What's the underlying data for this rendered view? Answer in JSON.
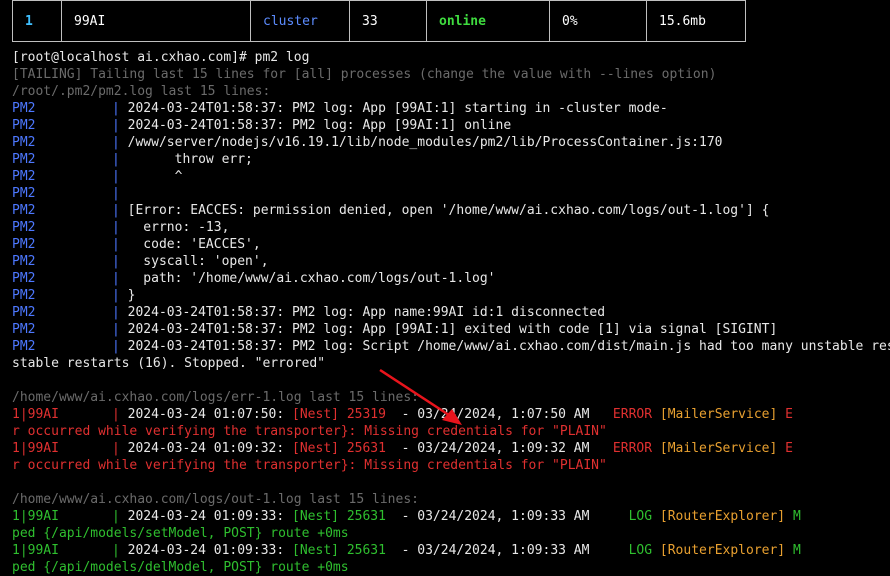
{
  "process_row": {
    "id": "1",
    "name": "99AI",
    "mode": "cluster",
    "restarts": "33",
    "status": "online",
    "cpu": "0%",
    "memory": "15.6mb"
  },
  "prompt": "[root@localhost ai.cxhao.com]# pm2 log",
  "tailing": "[TAILING] Tailing last 15 lines for [all] processes (change the value with --lines option)",
  "pm2_log_path": "/root/.pm2/pm2.log last 15 lines:",
  "pm2_prefix": "PM2",
  "pm2_lines": [
    "2024-03-24T01:58:37: PM2 log: App [99AI:1] starting in -cluster mode-",
    "2024-03-24T01:58:37: PM2 log: App [99AI:1] online",
    "/www/server/nodejs/v16.19.1/lib/node_modules/pm2/lib/ProcessContainer.js:170",
    "      throw err;",
    "      ^",
    "",
    "[Error: EACCES: permission denied, open '/home/www/ai.cxhao.com/logs/out-1.log'] {",
    "  errno: -13,",
    "  code: 'EACCES',",
    "  syscall: 'open',",
    "  path: '/home/www/ai.cxhao.com/logs/out-1.log'",
    "}",
    "2024-03-24T01:58:37: PM2 log: App name:99AI id:1 disconnected",
    "2024-03-24T01:58:37: PM2 log: App [99AI:1] exited with code [1] via signal [SIGINT]",
    "2024-03-24T01:58:37: PM2 log: Script /home/www/ai.cxhao.com/dist/main.js had too many unstable restarts (16). Stopped. \"errored\""
  ],
  "wrap_line": "stable restarts (16). Stopped. \"errored\"",
  "err_log_path": "/home/www/ai.cxhao.com/logs/err-1.log last 15 lines:",
  "err_prefix": "1|99AI",
  "err_entries": [
    {
      "ts": "2024-03-24 01:07:50: ",
      "nest": "[Nest] 25319",
      "dash": "  - ",
      "date": "03/24/2024, 1:07:50 AM",
      "level": "   ERROR ",
      "ctx": "[MailerService]",
      "tail": " E",
      "cont": "r occurred while verifying the transporter}: Missing credentials for \"PLAIN\""
    },
    {
      "ts": "2024-03-24 01:09:32: ",
      "nest": "[Nest] 25631",
      "dash": "  - ",
      "date": "03/24/2024, 1:09:32 AM",
      "level": "   ERROR ",
      "ctx": "[MailerService]",
      "tail": " E",
      "cont": "r occurred while verifying the transporter}: Missing credentials for \"PLAIN\""
    }
  ],
  "out_log_path": "/home/www/ai.cxhao.com/logs/out-1.log last 15 lines:",
  "out_prefix": "1|99AI",
  "out_entries": [
    {
      "ts": "2024-03-24 01:09:33: ",
      "nest": "[Nest] 25631",
      "dash": "  - ",
      "date": "03/24/2024, 1:09:33 AM",
      "level": "     LOG ",
      "ctx": "[RouterExplorer]",
      "tail": " M",
      "cont": "ped {/api/models/setModel, POST} route +0ms"
    },
    {
      "ts": "2024-03-24 01:09:33: ",
      "nest": "[Nest] 25631",
      "dash": "  - ",
      "date": "03/24/2024, 1:09:33 AM",
      "level": "     LOG ",
      "ctx": "[RouterExplorer]",
      "tail": " M",
      "cont": "ped {/api/models/delModel, POST} route +0ms"
    }
  ],
  "annotation_color": "#e8141c"
}
